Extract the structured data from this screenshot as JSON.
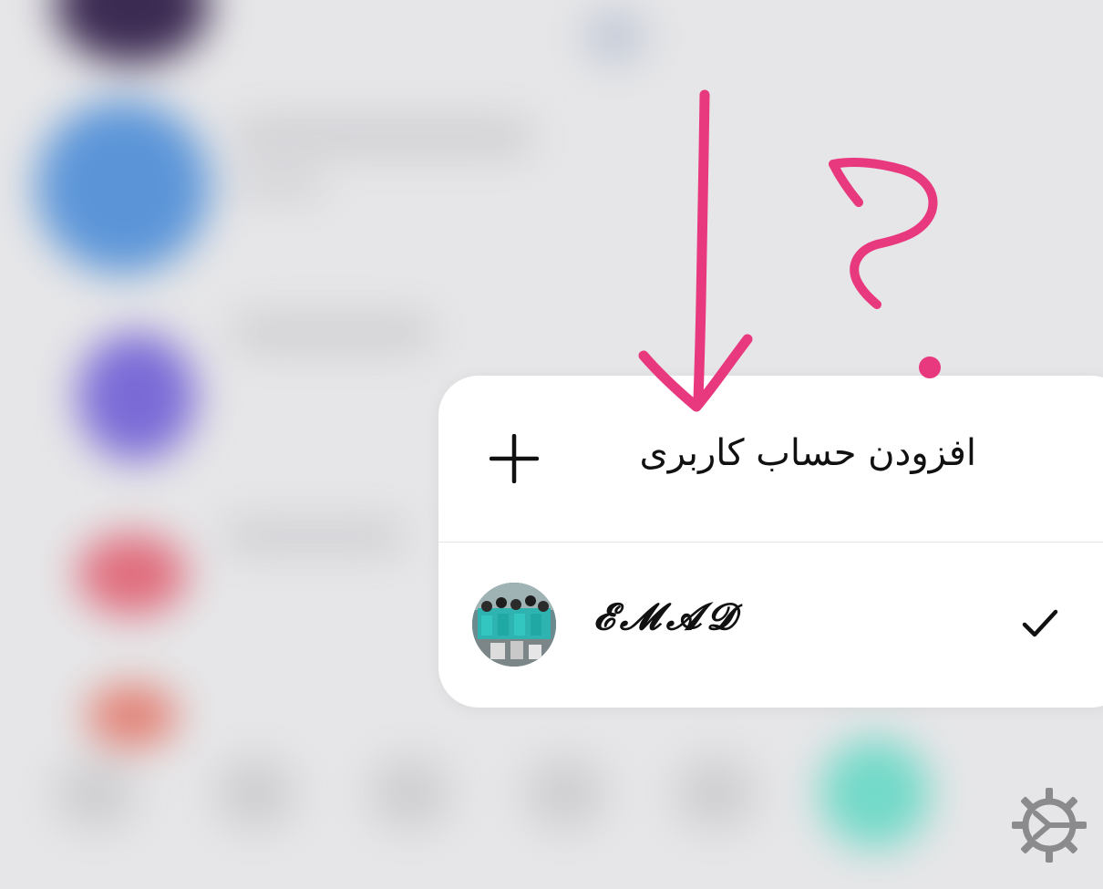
{
  "menu": {
    "add_account_label": "افزودن حساب کاربری",
    "account_name": "𝓔𝓜𝓐𝓓",
    "selected": true
  },
  "icons": {
    "add": "plus-icon",
    "selected": "checkmark-icon",
    "settings": "gear-icon",
    "annotation_arrow": "arrow-down-annotation",
    "annotation_question": "question-mark-annotation"
  },
  "colors": {
    "annotation": "#e8397f",
    "menu_background": "#ffffff",
    "backdrop": "#e6e6e8"
  }
}
